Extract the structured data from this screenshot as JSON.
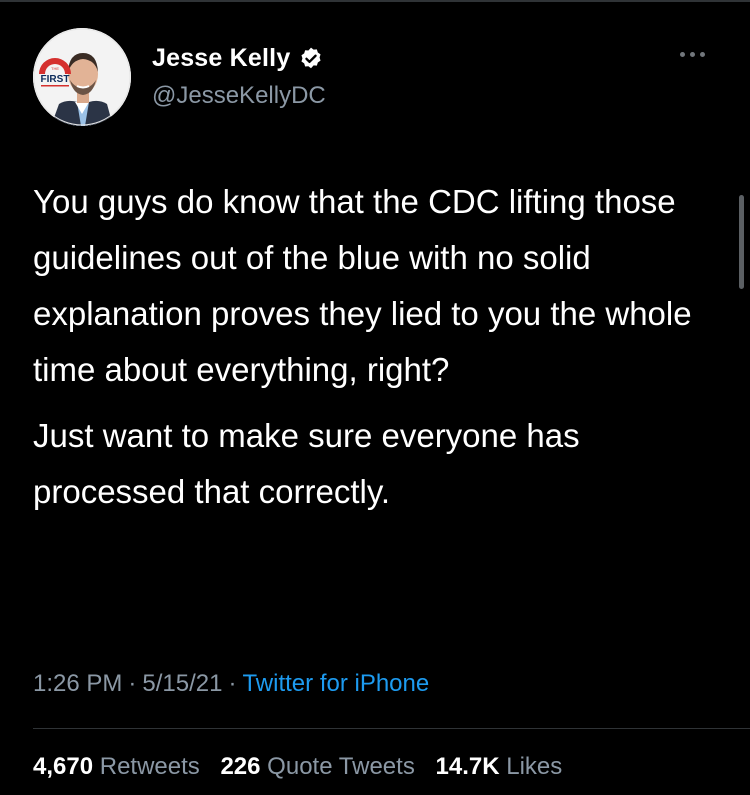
{
  "user": {
    "name": "Jesse Kelly",
    "handle": "@JesseKellyDC",
    "avatar_badge": "FIRST",
    "avatar_badge_small": "THE"
  },
  "tweet": {
    "paragraphs": [
      "You guys do know that the CDC lifting those guidelines out of the blue with no solid explanation proves they lied to you the whole time about everything, right?",
      "Just want to make sure everyone has processed that correctly."
    ],
    "time": "1:26 PM",
    "date": "5/15/21",
    "source": "Twitter for iPhone"
  },
  "stats": {
    "retweets_count": "4,670",
    "retweets_label": "Retweets",
    "quotes_count": "226",
    "quotes_label": "Quote Tweets",
    "likes_count": "14.7K",
    "likes_label": "Likes"
  },
  "colors": {
    "background": "#000000",
    "text": "#ffffff",
    "secondary": "#8b98a5",
    "link": "#1d9bf0",
    "divider": "#2f3336"
  },
  "icons": {
    "verified": "verified-badge-icon",
    "more": "more-options-icon"
  }
}
